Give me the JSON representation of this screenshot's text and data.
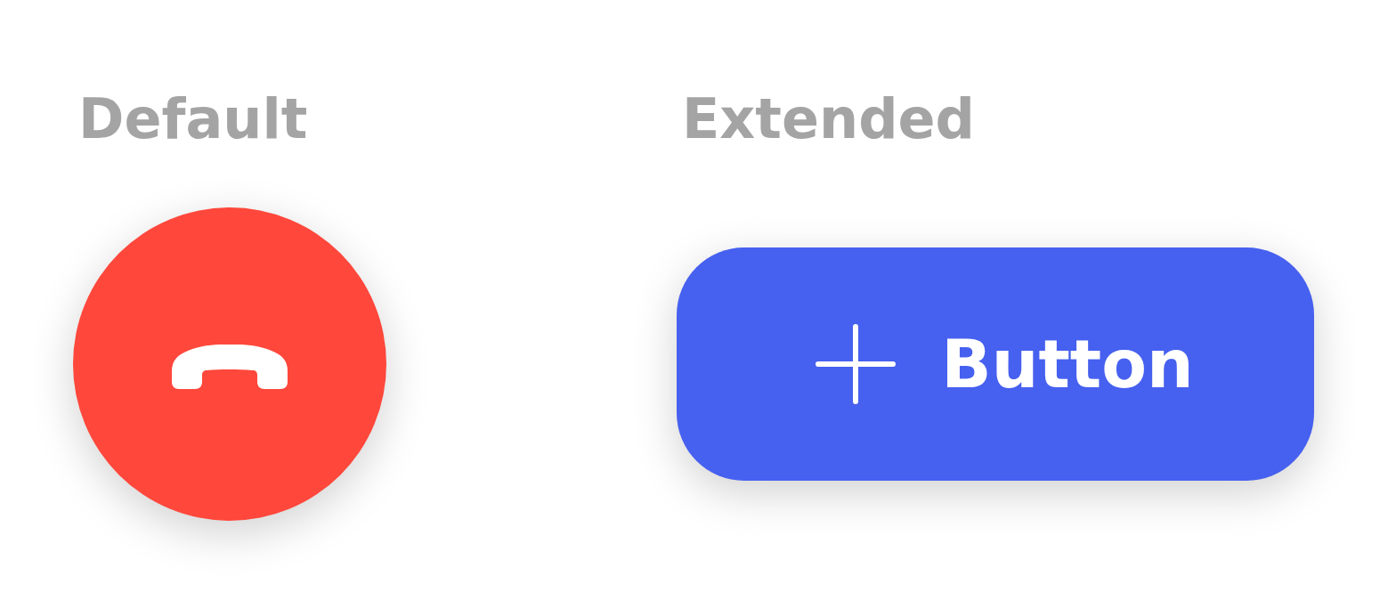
{
  "sections": [
    {
      "kind": "round",
      "heading": "Default"
    },
    {
      "kind": "extended",
      "heading": "Extended",
      "button_label": "Button"
    }
  ]
}
